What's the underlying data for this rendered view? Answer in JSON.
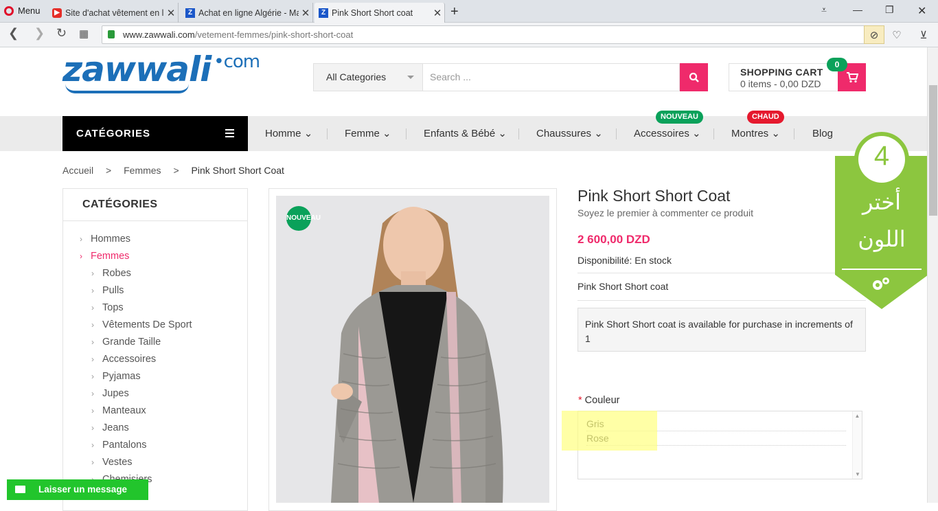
{
  "browser": {
    "menu_label": "Menu",
    "tabs": [
      {
        "title": "Site d'achat vêtement en li",
        "icon": "youtube-icon",
        "active": false
      },
      {
        "title": "Achat en ligne Algérie - Ma",
        "icon": "zawwali-icon",
        "active": false
      },
      {
        "title": "Pink Short Short coat",
        "icon": "zawwali-icon",
        "active": true
      }
    ],
    "url_host": "www.zawwali.com",
    "url_path": "/vetement-femmes/pink-short-short-coat"
  },
  "header": {
    "logo_text": "zawwali",
    "logo_suffix": "com",
    "search_category": "All Categories",
    "search_placeholder": "Search ...",
    "cart_title": "SHOPPING CART",
    "cart_summary": "0 items - 0,00 DZD",
    "cart_count": "0"
  },
  "nav": {
    "categories_label": "CATÉGORIES",
    "items": [
      {
        "label": "Homme"
      },
      {
        "label": "Femme"
      },
      {
        "label": "Enfants & Bébé"
      },
      {
        "label": "Chaussures"
      },
      {
        "label": "Accessoires",
        "badge": "NOUVEAU"
      },
      {
        "label": "Montres",
        "badge": "CHAUD"
      },
      {
        "label": "Blog"
      }
    ]
  },
  "breadcrumb": [
    "Accueil",
    ">",
    "Femmes",
    ">",
    "Pink Short Short Coat"
  ],
  "sidebar": {
    "title": "CATÉGORIES",
    "items": [
      {
        "label": "Hommes",
        "level": 0,
        "active": false
      },
      {
        "label": "Femmes",
        "level": 0,
        "active": true
      },
      {
        "label": "Robes",
        "level": 1
      },
      {
        "label": "Pulls",
        "level": 1
      },
      {
        "label": "Tops",
        "level": 1
      },
      {
        "label": "Vêtements De Sport",
        "level": 1
      },
      {
        "label": "Grande Taille",
        "level": 1
      },
      {
        "label": "Accessoires",
        "level": 1
      },
      {
        "label": "Pyjamas",
        "level": 1
      },
      {
        "label": "Jupes",
        "level": 1
      },
      {
        "label": "Manteaux",
        "level": 1
      },
      {
        "label": "Jeans",
        "level": 1
      },
      {
        "label": "Pantalons",
        "level": 1
      },
      {
        "label": "Vestes",
        "level": 1
      },
      {
        "label": "Chemisiers",
        "level": 1
      }
    ]
  },
  "product": {
    "badge": "NOUVEAU",
    "title": "Pink Short Short Coat",
    "review_link": "Soyez le premier à commenter ce produit",
    "price": "2 600,00 DZD",
    "availability": "Disponibilité: En stock",
    "short_desc": "Pink Short Short coat",
    "increment_note": "Pink Short Short coat is available for purchase in increments of 1",
    "option_required": "*",
    "option_label": " Couleur",
    "options": [
      "Gris",
      "Rose"
    ]
  },
  "banner": {
    "number": "4",
    "line1": "أختر",
    "line2": "اللون"
  },
  "chat": {
    "label": "Laisser un message"
  },
  "colors": {
    "accent": "#ef2a6b",
    "green": "#0aa15a",
    "red": "#e5192e",
    "logo": "#1c6fb8",
    "chat": "#22c52c"
  }
}
